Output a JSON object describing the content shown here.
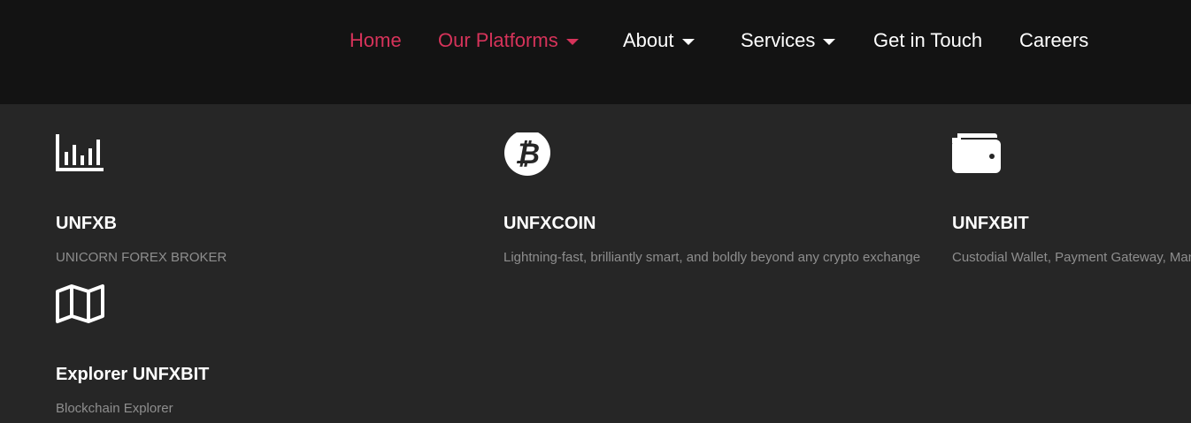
{
  "nav": {
    "items": [
      {
        "label": "Home",
        "active": true,
        "dropdown": false
      },
      {
        "label": "Our Platforms",
        "active": true,
        "dropdown": true
      },
      {
        "label": "About",
        "active": false,
        "dropdown": true
      },
      {
        "label": "Services",
        "active": false,
        "dropdown": true
      },
      {
        "label": "Get in Touch",
        "active": false,
        "dropdown": false
      },
      {
        "label": "Careers",
        "active": false,
        "dropdown": false
      }
    ]
  },
  "platforms": [
    {
      "icon": "bar-chart-icon",
      "title": "UNFXB",
      "description": "UNICORN FOREX BROKER"
    },
    {
      "icon": "bitcoin-icon",
      "title": "UNFXCOIN",
      "description": "Lightning-fast, brilliantly smart, and boldly beyond any crypto exchange"
    },
    {
      "icon": "wallet-icon",
      "title": "UNFXBIT",
      "description": "Custodial Wallet, Payment Gateway, Managed Assets"
    },
    {
      "icon": "map-icon",
      "title": "Explorer UNFXBIT",
      "description": "Blockchain Explorer"
    }
  ],
  "colors": {
    "accent": "#d6335a",
    "header_bg": "#131313",
    "panel_bg": "#262626",
    "text": "#ffffff",
    "muted_text": "#8e8e8e"
  }
}
